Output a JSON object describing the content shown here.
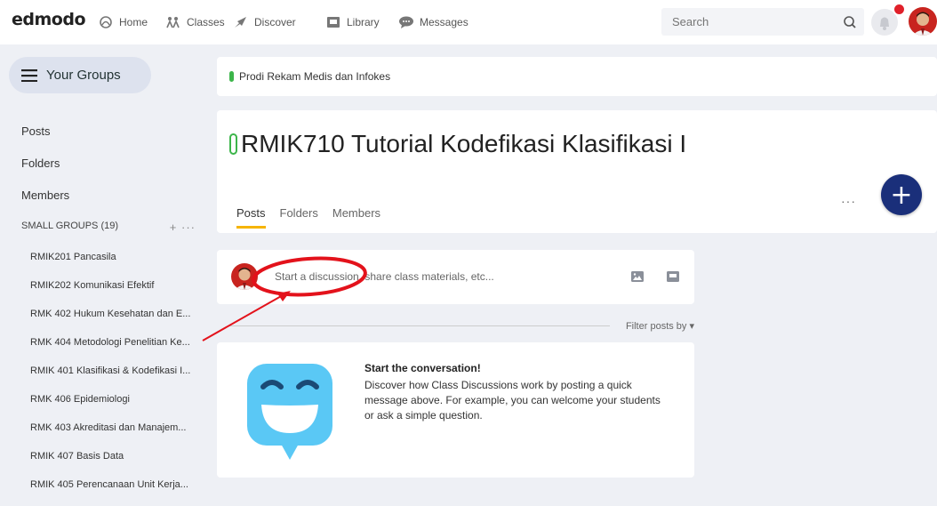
{
  "topbar": {
    "logo": "edmodo",
    "nav": [
      {
        "label": "Home",
        "icon": "home-icon"
      },
      {
        "label": "Classes",
        "icon": "classes-icon"
      },
      {
        "label": "Discover",
        "icon": "discover-icon"
      },
      {
        "label": "Library",
        "icon": "library-icon"
      },
      {
        "label": "Messages",
        "icon": "messages-icon"
      }
    ],
    "search_placeholder": "Search",
    "notification_icon": "bell-icon"
  },
  "sidebar": {
    "your_groups_label": "Your Groups",
    "links": [
      "Posts",
      "Folders",
      "Members"
    ],
    "small_groups_label": "SMALL GROUPS (19)",
    "small_groups_actions": "+ ···",
    "groups": [
      "RMIK201 Pancasila",
      "RMIK202 Komunikasi Efektif",
      "RMK 402 Hukum Kesehatan dan E...",
      "RMK 404 Metodologi Penelitian Ke...",
      "RMIK 401 Klasifikasi & Kodefikasi I...",
      "RMK 406 Epidemiologi",
      "RMK 403 Akreditasi dan Manajem...",
      "RMIK 407 Basis Data",
      "RMIK 405 Perencanaan Unit Kerja..."
    ]
  },
  "main": {
    "school_name": "Prodi Rekam Medis dan Infokes",
    "class_title": "RMIK710 Tutorial Kodefikasi Klasifikasi I",
    "tabs": [
      "Posts",
      "Folders",
      "Members"
    ],
    "active_tab": "Posts",
    "more_label": "···",
    "add_label": "+",
    "composer_placeholder": "Start a discussion, share class materials, etc...",
    "filter_label": "Filter posts by ▾",
    "empty_title": "Start the conversation!",
    "empty_body": "Discover how Class Discussions work by posting a quick message above. For example, you can welcome your students or ask a simple question."
  },
  "colors": {
    "accent_green": "#3cb54a",
    "tab_underline": "#f6b400",
    "add_button": "#1a2f7a",
    "badge_red": "#e0202a",
    "annotation_red": "#e3121b"
  }
}
